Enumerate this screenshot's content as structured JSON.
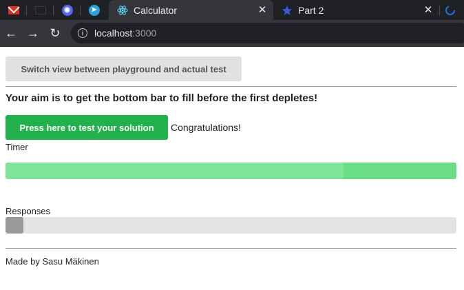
{
  "browser": {
    "tabs": [
      {
        "title": "Calculator",
        "active": true,
        "favicon": "react-icon"
      },
      {
        "title": "Part 2",
        "active": false,
        "favicon": "star-icon"
      }
    ],
    "pinned_tabs": [
      "gmail-icon",
      "gmail-icon",
      "discord-icon",
      "telegram-icon"
    ],
    "url_host": "localhost",
    "url_port": ":3000"
  },
  "page": {
    "switch_button": "Switch view between playground and actual test",
    "aim_text": "Your aim is to get the bottom bar to fill before the first depletes!",
    "test_button": "Press here to test your solution",
    "result_text": "Congratulations!",
    "timer_label": "Timer",
    "timer_progress": 0.75,
    "responses_label": "Responses",
    "responses_progress": 0.04,
    "footer": "Made by Sasu Mäkinen"
  },
  "colors": {
    "test_button": "#22b14c",
    "timer_bar": "#7fe39a",
    "responses_bar": "#999999",
    "bar_track": "#e3e3e3"
  }
}
